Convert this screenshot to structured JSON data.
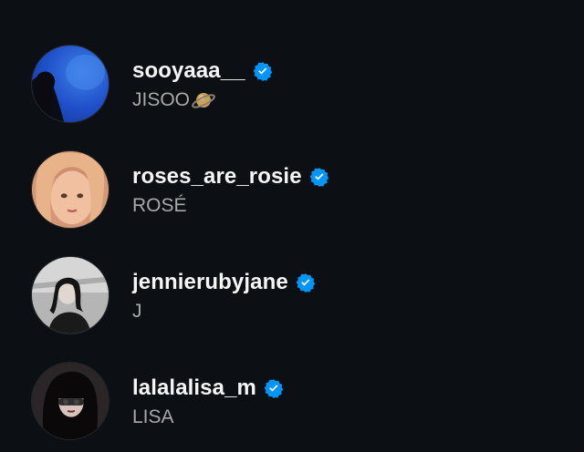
{
  "accounts": [
    {
      "username": "sooyaaa__",
      "full_name": "JISOO",
      "verified": true,
      "name_emoji": "ringed-planet-icon",
      "avatar_icon": "avatar-photo-blue"
    },
    {
      "username": "roses_are_rosie",
      "full_name": "ROSÉ",
      "verified": true,
      "avatar_icon": "avatar-photo-warm"
    },
    {
      "username": "jennierubyjane",
      "full_name": "J",
      "verified": true,
      "avatar_icon": "avatar-photo-monochrome"
    },
    {
      "username": "lalalalisa_m",
      "full_name": "LISA",
      "verified": true,
      "avatar_icon": "avatar-photo-dark"
    }
  ],
  "colors": {
    "background": "#0c1014",
    "username_text": "#f5f5f5",
    "fullname_text": "#a8a8a8",
    "verified_badge": "#0095f6"
  }
}
